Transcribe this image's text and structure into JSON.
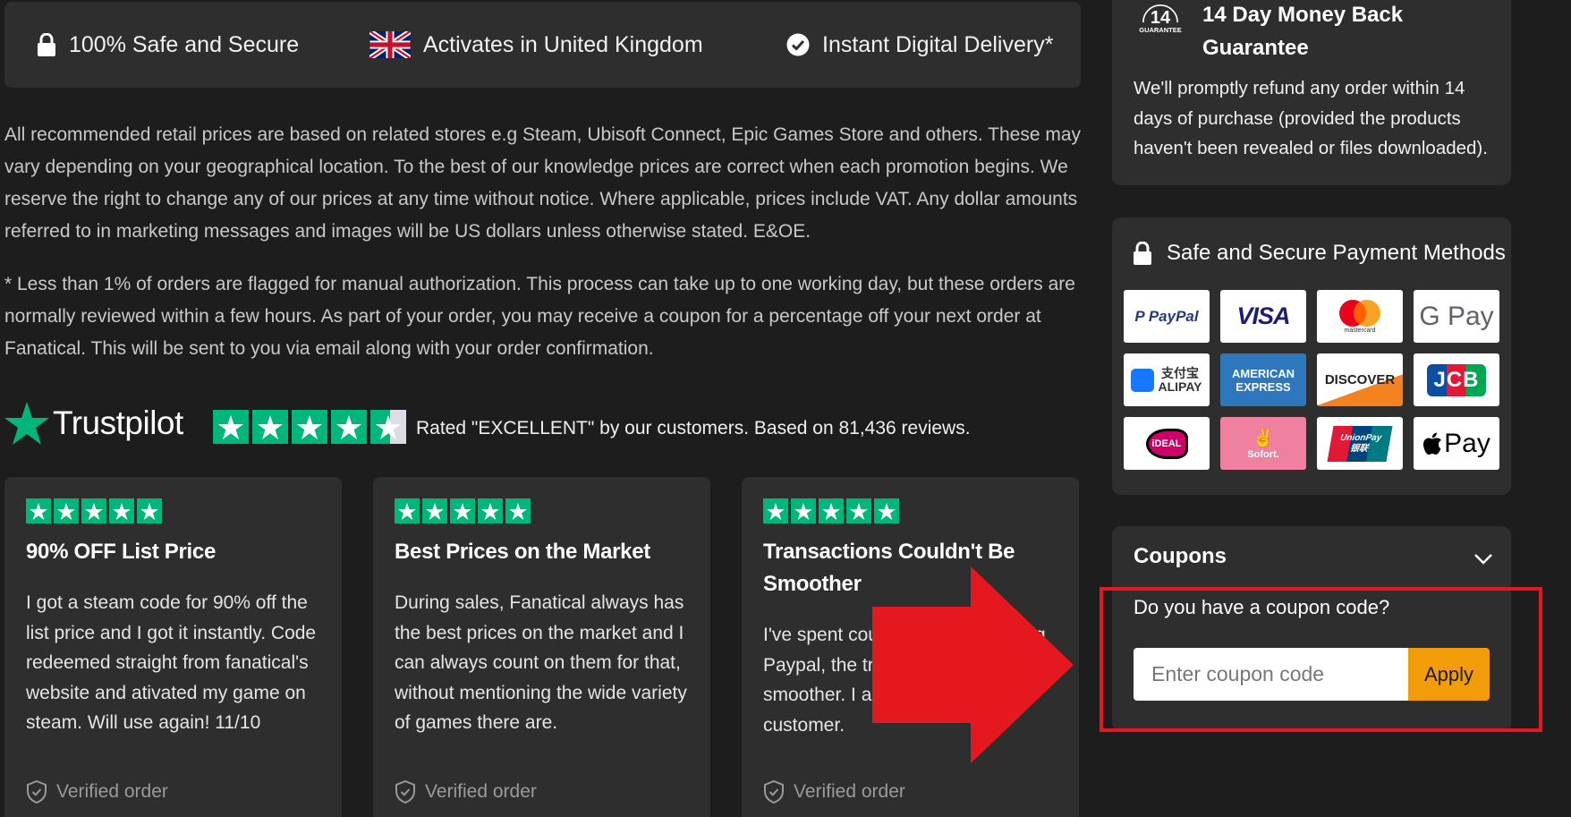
{
  "trust_bar": {
    "items": [
      {
        "icon": "lock-icon",
        "label": "100% Safe and Secure"
      },
      {
        "icon": "uk-flag-icon",
        "label": "Activates in United Kingdom"
      },
      {
        "icon": "check-circle-icon",
        "label": "Instant Digital Delivery*"
      }
    ]
  },
  "disclaimer": {
    "prices": "All recommended retail prices are based on related stores e.g Steam, Ubisoft Connect, Epic Games Store and others. These may vary depending on your geographical location. To the best of our knowledge prices are correct when each promotion begins. We reserve the right to change any of our prices at any time without notice. Where applicable, prices include VAT. Any dollar amounts referred to in marketing messages and images will be US dollars unless otherwise stated. E&OE.",
    "authorization": "* Less than 1% of orders are flagged for manual authorization. This process can take up to one working day, but these orders are normally reviewed within a few hours. As part of your order, you may receive a coupon for a percentage off your next order at Fanatical. This will be sent to you via email along with your order confirmation."
  },
  "trustpilot": {
    "name": "Trustpilot",
    "rating_stars": 4.5,
    "summary": "Rated \"EXCELLENT\" by our customers. Based on 81,436 reviews."
  },
  "reviews": [
    {
      "title": "90% OFF List Price",
      "body": "I got a steam code for 90% off the list price and I got it instantly. Code redeemed straight from fanatical's website and ativated my game on steam. Will use again! 11/10",
      "verified": "Verified order",
      "stars": 5
    },
    {
      "title": "Best Prices on the Market",
      "body": "During sales, Fanatical always has the best prices on the market and I can always count on them for that, without mentioning the wide variety of games there are.",
      "verified": "Verified order",
      "stars": 5
    },
    {
      "title": "Transactions Couldn't Be Smoother",
      "body": "I've spent cou Fanatical has using Paypal, the transact could not be smoother. I am a very satisfied customer.",
      "verified": "Verified order",
      "stars": 5
    }
  ],
  "guarantee": {
    "badge_number": "14",
    "badge_text": "GUARANTEE",
    "title": "14 Day Money Back Guarantee",
    "body": "We'll promptly refund any order within 14 days of purchase (provided the products haven't been revealed or files downloaded)."
  },
  "payment": {
    "title": "Safe and Secure Payment Methods",
    "methods": [
      "PayPal",
      "VISA",
      "mastercard",
      "G Pay",
      "支付宝 ALIPAY",
      "AMERICAN EXPRESS",
      "DISCOVER",
      "JCB",
      "iDEAL",
      "Sofort.",
      "UnionPay 银联",
      "Pay"
    ]
  },
  "coupons": {
    "title": "Coupons",
    "question": "Do you have a coupon code?",
    "input_placeholder": "Enter coupon code",
    "apply_label": "Apply"
  },
  "colors": {
    "background": "#1d1d1d",
    "panel": "#2e2e2e",
    "trustpilot_green": "#00b67a",
    "apply_orange": "#f29c0a",
    "annotation_red": "#e5181f"
  }
}
